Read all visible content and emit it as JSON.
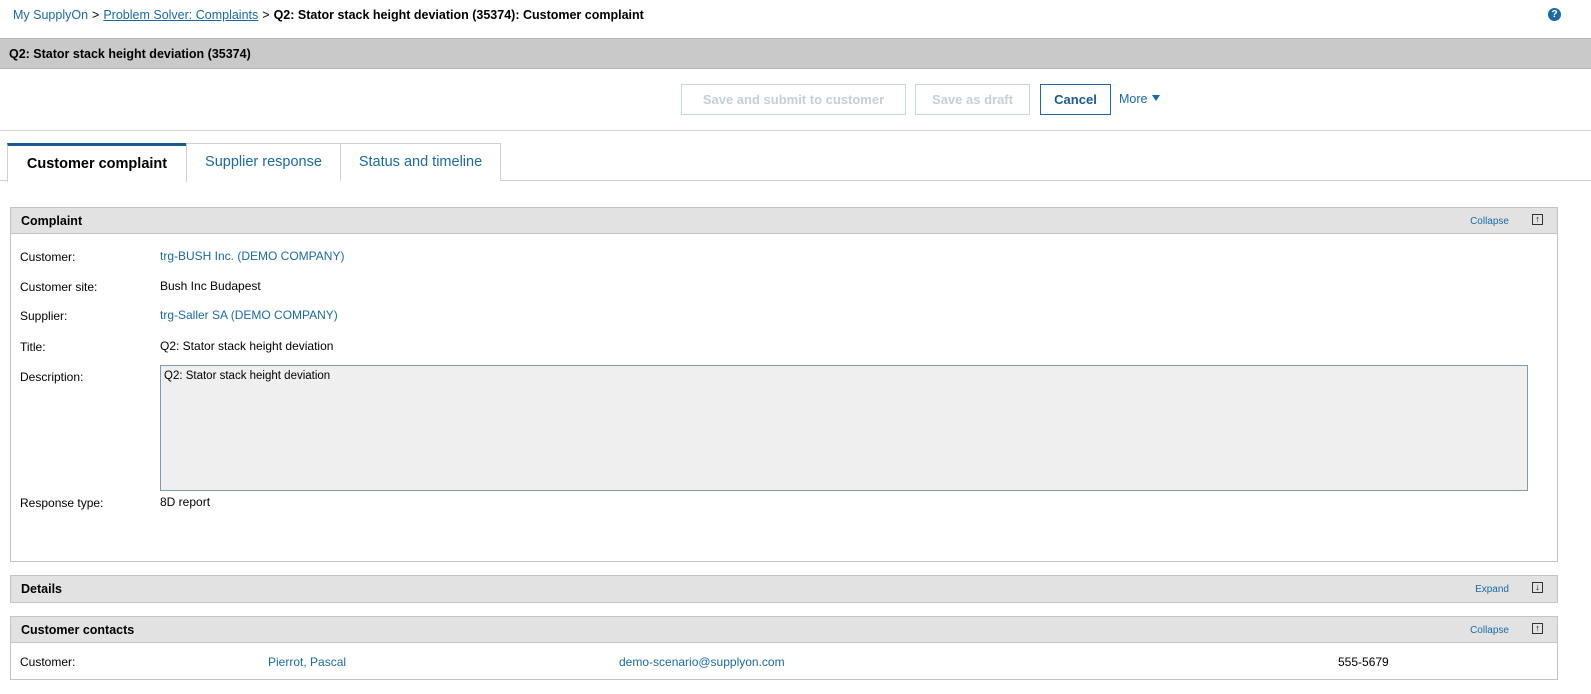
{
  "breadcrumb": {
    "home": "My SupplyOn",
    "sep1": ">",
    "section": "Problem Solver: Complaints",
    "sep2": ">",
    "current": "Q2: Stator stack height deviation (35374): Customer complaint"
  },
  "help_icon": {
    "glyph": "?",
    "name": "help-icon"
  },
  "title_bar": "Q2: Stator stack height deviation (35374)",
  "toolbar": {
    "submit_label": "Save and submit to customer",
    "draft_label": "Save as draft",
    "cancel_label": "Cancel",
    "more_label": "More"
  },
  "tabs": [
    {
      "label": "Customer complaint",
      "active": true
    },
    {
      "label": "Supplier response",
      "active": false
    },
    {
      "label": "Status and timeline",
      "active": false
    }
  ],
  "complaint": {
    "title": "Complaint",
    "toggle": "Collapse",
    "fields": {
      "customer_label": "Customer:",
      "customer_value": "trg-BUSH Inc. (DEMO COMPANY)",
      "site_label": "Customer site:",
      "site_value": "Bush Inc Budapest",
      "supplier_label": "Supplier:",
      "supplier_value": "trg-Saller SA (DEMO COMPANY)",
      "title_label": "Title:",
      "title_value": "Q2: Stator stack height deviation",
      "description_label": "Description:",
      "description_value": "Q2: Stator stack height deviation",
      "response_label": "Response type:",
      "response_value": "8D report"
    }
  },
  "details": {
    "title": "Details",
    "toggle": "Expand"
  },
  "customer_contacts": {
    "title": "Customer contacts",
    "toggle": "Collapse",
    "row": {
      "role": "Customer:",
      "name": "Pierrot, Pascal",
      "email": "demo-scenario@supplyon.com",
      "phone": "555-5679"
    }
  },
  "colors": {
    "link": "#1a6aa8",
    "title_bar": "#c9c9c9",
    "panel_header": "#e2e2e2"
  }
}
